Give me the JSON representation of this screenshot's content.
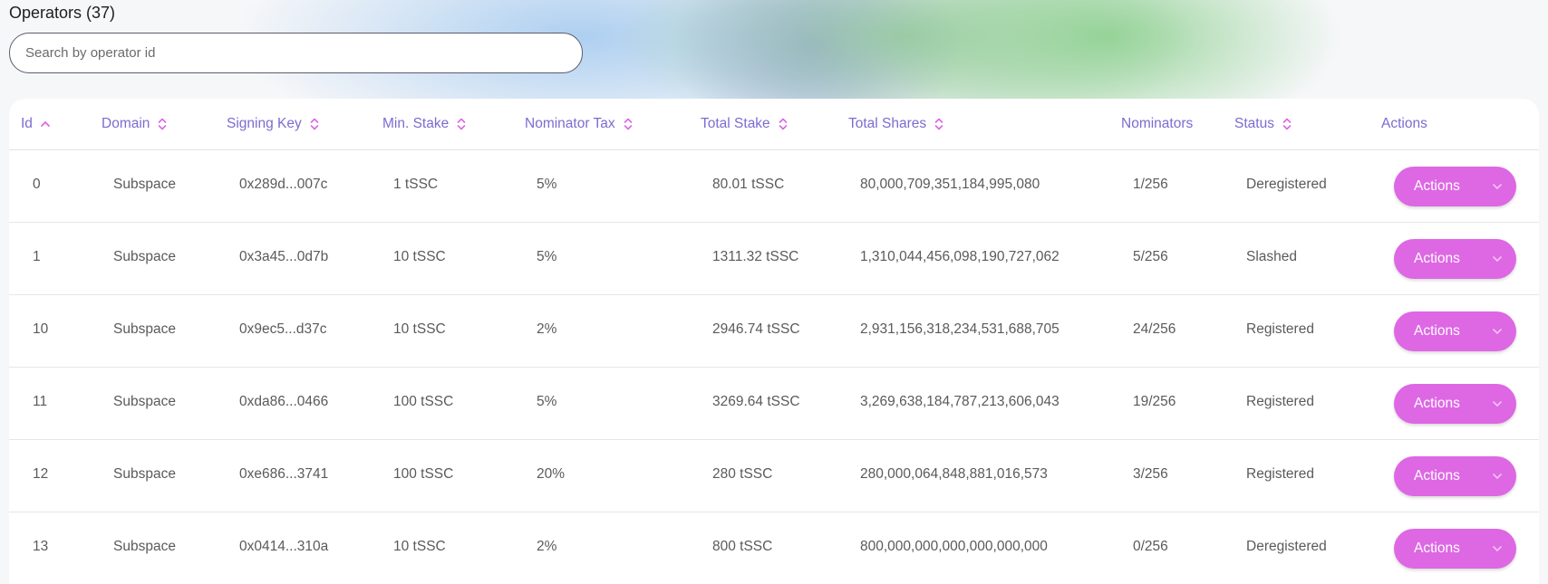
{
  "page": {
    "title": "Operators (37)"
  },
  "search": {
    "placeholder": "Search by operator id",
    "value": ""
  },
  "colors": {
    "accent": "#de67e4",
    "header_text": "#7d6bd0",
    "body_text": "#5a5a5a"
  },
  "table": {
    "headers": {
      "id": "Id",
      "domain": "Domain",
      "signing_key": "Signing Key",
      "min_stake": "Min. Stake",
      "nominator_tax": "Nominator Tax",
      "total_stake": "Total Stake",
      "total_shares": "Total Shares",
      "nominators": "Nominators",
      "status": "Status",
      "actions": "Actions"
    },
    "sort": {
      "column": "id",
      "direction": "asc",
      "icons": {
        "active": "chevron-up-icon",
        "inactive": "sort-icon"
      }
    },
    "rows": [
      {
        "id": "0",
        "domain": "Subspace",
        "signing_key": "0x289d...007c",
        "min_stake": "1 tSSC",
        "nominator_tax": "5%",
        "total_stake": "80.01 tSSC",
        "total_shares": "80,000,709,351,184,995,080",
        "nominators": "1/256",
        "status": "Deregistered",
        "action": "Actions"
      },
      {
        "id": "1",
        "domain": "Subspace",
        "signing_key": "0x3a45...0d7b",
        "min_stake": "10 tSSC",
        "nominator_tax": "5%",
        "total_stake": "1311.32 tSSC",
        "total_shares": "1,310,044,456,098,190,727,062",
        "nominators": "5/256",
        "status": "Slashed",
        "action": "Actions"
      },
      {
        "id": "10",
        "domain": "Subspace",
        "signing_key": "0x9ec5...d37c",
        "min_stake": "10 tSSC",
        "nominator_tax": "2%",
        "total_stake": "2946.74 tSSC",
        "total_shares": "2,931,156,318,234,531,688,705",
        "nominators": "24/256",
        "status": "Registered",
        "action": "Actions"
      },
      {
        "id": "11",
        "domain": "Subspace",
        "signing_key": "0xda86...0466",
        "min_stake": "100 tSSC",
        "nominator_tax": "5%",
        "total_stake": "3269.64 tSSC",
        "total_shares": "3,269,638,184,787,213,606,043",
        "nominators": "19/256",
        "status": "Registered",
        "action": "Actions"
      },
      {
        "id": "12",
        "domain": "Subspace",
        "signing_key": "0xe686...3741",
        "min_stake": "100 tSSC",
        "nominator_tax": "20%",
        "total_stake": "280 tSSC",
        "total_shares": "280,000,064,848,881,016,573",
        "nominators": "3/256",
        "status": "Registered",
        "action": "Actions"
      },
      {
        "id": "13",
        "domain": "Subspace",
        "signing_key": "0x0414...310a",
        "min_stake": "10 tSSC",
        "nominator_tax": "2%",
        "total_stake": "800 tSSC",
        "total_shares": "800,000,000,000,000,000,000",
        "nominators": "0/256",
        "status": "Deregistered",
        "action": "Actions"
      }
    ]
  }
}
